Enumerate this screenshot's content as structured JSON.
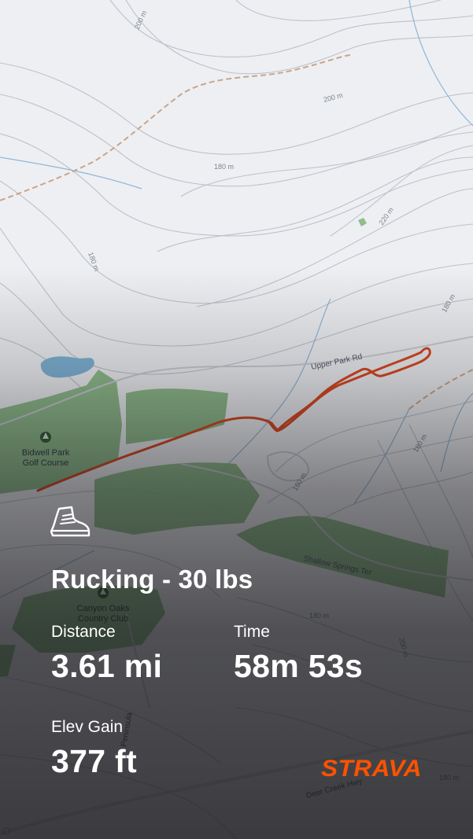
{
  "activity": {
    "icon": "hiking-boot-icon",
    "title": "Rucking - 30 lbs"
  },
  "stats": {
    "distance": {
      "label": "Distance",
      "value": "3.61 mi"
    },
    "time": {
      "label": "Time",
      "value": "58m 53s"
    },
    "elev_gain": {
      "label": "Elev Gain",
      "value": "377 ft"
    }
  },
  "brand": {
    "name": "STRAVA",
    "color": "#fc5200"
  },
  "map": {
    "route_color": "#d9461f",
    "park_color": "#7fb47a",
    "water_color": "#7eb3d6",
    "contour_labels": [
      "200 m",
      "200 m",
      "180 m",
      "220 m",
      "180 m",
      "180 m",
      "160 m",
      "180 m",
      "180 m",
      "200 m",
      "180 m"
    ],
    "places": {
      "golf_course_line1": "Bidwell Park",
      "golf_course_line2": "Golf Course",
      "country_club_line1": "Canyon Oaks",
      "country_club_line2": "Country Club"
    },
    "roads": {
      "upper_park": "Upper Park Rd",
      "shallow_springs": "Shallow Springs Ter",
      "deer_creek": "Deer Creek Hwy",
      "peninsula": "Peninsula"
    }
  }
}
